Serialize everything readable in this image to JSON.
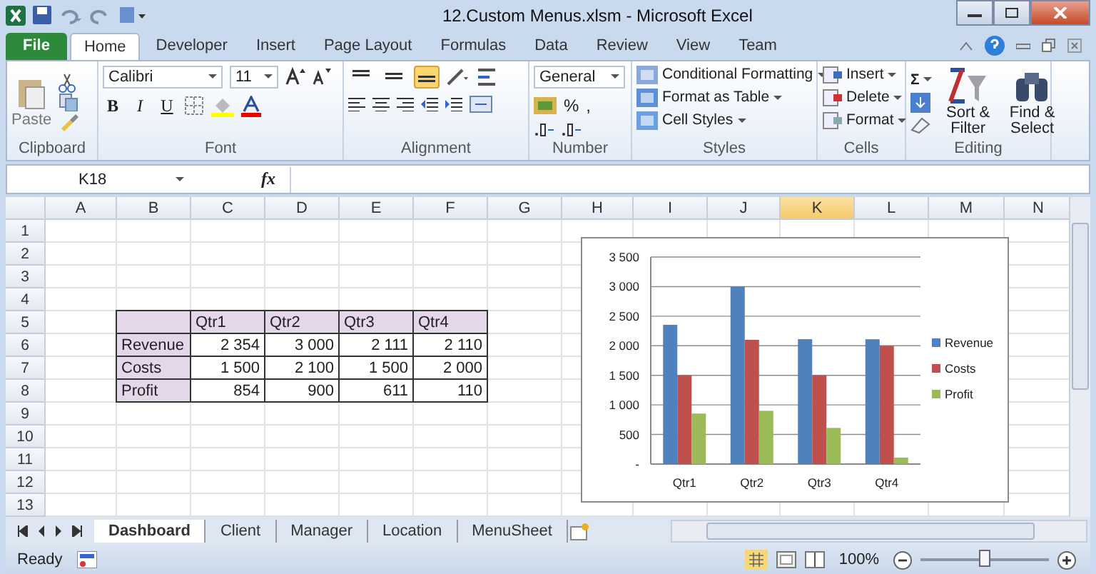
{
  "window": {
    "title": "12.Custom Menus.xlsm  -  Microsoft Excel"
  },
  "ribbon_tabs": [
    {
      "label": "File",
      "kind": "file",
      "selected": false
    },
    {
      "label": "Home",
      "kind": "tab",
      "selected": true
    },
    {
      "label": "Developer",
      "kind": "tab",
      "selected": false
    },
    {
      "label": "Insert",
      "kind": "tab",
      "selected": false
    },
    {
      "label": "Page Layout",
      "kind": "tab",
      "selected": false
    },
    {
      "label": "Formulas",
      "kind": "tab",
      "selected": false
    },
    {
      "label": "Data",
      "kind": "tab",
      "selected": false
    },
    {
      "label": "Review",
      "kind": "tab",
      "selected": false
    },
    {
      "label": "View",
      "kind": "tab",
      "selected": false
    },
    {
      "label": "Team",
      "kind": "tab",
      "selected": false
    }
  ],
  "clipboard": {
    "label": "Clipboard",
    "paste": "Paste"
  },
  "font": {
    "label": "Font",
    "name": "Calibri",
    "size": "11",
    "bold": "B",
    "italic": "I",
    "underline": "U"
  },
  "alignment": {
    "label": "Alignment",
    "buttons": [
      {
        "selected": false
      },
      {
        "selected": false
      },
      {
        "selected": true
      }
    ]
  },
  "number": {
    "label": "Number",
    "format": "General",
    "percent": "%",
    "comma": ","
  },
  "styles": {
    "label": "Styles",
    "items": [
      "Conditional Formatting",
      "Format as Table",
      "Cell Styles"
    ]
  },
  "cells": {
    "label": "Cells",
    "items": [
      "Insert",
      "Delete",
      "Format"
    ]
  },
  "editing": {
    "label": "Editing",
    "autosum": "Σ",
    "sort": "Sort & Filter",
    "find": "Find & Select"
  },
  "formula_bar": {
    "name_box": "K18",
    "fx": "fx"
  },
  "columns": [
    {
      "label": "A",
      "selected": false
    },
    {
      "label": "B",
      "selected": false
    },
    {
      "label": "C",
      "selected": false
    },
    {
      "label": "D",
      "selected": false
    },
    {
      "label": "E",
      "selected": false
    },
    {
      "label": "F",
      "selected": false
    },
    {
      "label": "G",
      "selected": false
    },
    {
      "label": "H",
      "selected": false
    },
    {
      "label": "I",
      "selected": false
    },
    {
      "label": "J",
      "selected": false
    },
    {
      "label": "K",
      "selected": true
    },
    {
      "label": "L",
      "selected": false
    },
    {
      "label": "M",
      "selected": false
    },
    {
      "label": "N",
      "selected": false
    }
  ],
  "rows": [
    "1",
    "2",
    "3",
    "4",
    "5",
    "6",
    "7",
    "8",
    "9",
    "10",
    "11",
    "12",
    "13"
  ],
  "table": {
    "columns": [
      "Qtr1",
      "Qtr2",
      "Qtr3",
      "Qtr4"
    ],
    "rows": [
      {
        "label": "Revenue",
        "cells": [
          "2 354",
          "3 000",
          "2 111",
          "2 110"
        ]
      },
      {
        "label": "Costs",
        "cells": [
          "1 500",
          "2 100",
          "1 500",
          "2 000"
        ]
      },
      {
        "label": "Profit",
        "cells": [
          "854",
          "900",
          "611",
          "110"
        ]
      }
    ]
  },
  "chart": {
    "chart_data": {
      "type": "bar",
      "categories": [
        "Qtr1",
        "Qtr2",
        "Qtr3",
        "Qtr4"
      ],
      "series": [
        {
          "name": "Revenue",
          "color": "#4f81bd",
          "values": [
            2354,
            3000,
            2111,
            2110
          ]
        },
        {
          "name": "Costs",
          "color": "#c0504d",
          "values": [
            1500,
            2100,
            1500,
            2000
          ]
        },
        {
          "name": "Profit",
          "color": "#9bbb59",
          "values": [
            854,
            900,
            611,
            110
          ]
        }
      ],
      "ylim": [
        0,
        3500
      ],
      "grid": true,
      "legend": true,
      "yticks": [
        {
          "value": 0,
          "label": "-"
        },
        {
          "value": 500,
          "label": "500"
        },
        {
          "value": 1000,
          "label": "1 000"
        },
        {
          "value": 1500,
          "label": "1 500"
        },
        {
          "value": 2000,
          "label": "2 000"
        },
        {
          "value": 2500,
          "label": "2 500"
        },
        {
          "value": 3000,
          "label": "3 000"
        },
        {
          "value": 3500,
          "label": "3 500"
        }
      ]
    }
  },
  "sheet_tabs": [
    {
      "label": "Dashboard",
      "selected": true
    },
    {
      "label": "Client",
      "selected": false
    },
    {
      "label": "Manager",
      "selected": false
    },
    {
      "label": "Location",
      "selected": false
    },
    {
      "label": "MenuSheet",
      "selected": false
    }
  ],
  "status_bar": {
    "status": "Ready",
    "zoom": "100%",
    "zoom_slider": {
      "level": 0.5
    }
  }
}
